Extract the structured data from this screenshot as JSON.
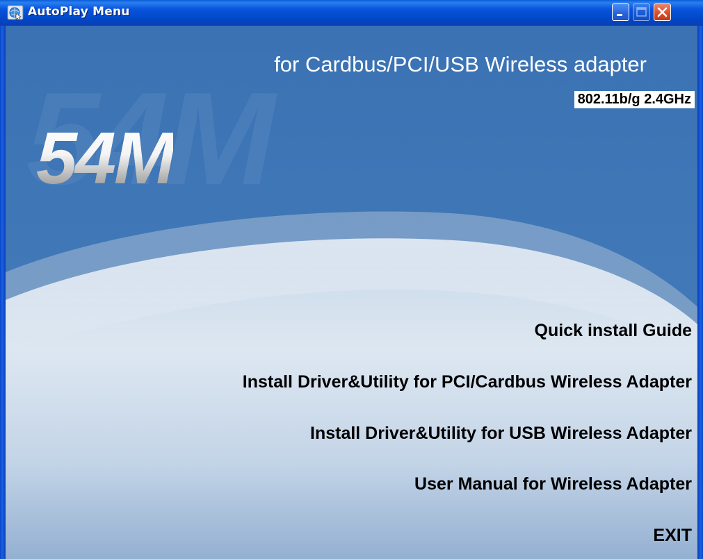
{
  "window": {
    "title": "AutoPlay Menu",
    "icon": "autoplay-globe-icon",
    "controls": [
      "minimize-icon",
      "maximize-icon",
      "close-icon"
    ]
  },
  "banner": {
    "subtitle": "for Cardbus/PCI/USB Wireless adapter",
    "spec": "802.11b/g  2.4GHz",
    "logo": "54M",
    "watermark": "54M"
  },
  "menu": {
    "quick_install": "Quick install Guide",
    "install_pci": "Install Driver&Utility for PCI/Cardbus Wireless Adapter",
    "install_usb": "Install Driver&Utility for USB Wireless Adapter",
    "user_manual": "User Manual for Wireless Adapter",
    "exit": "EXIT"
  },
  "colors": {
    "background": "#3f77b7",
    "titlebar": "#0855dd",
    "menu_text": "#000000",
    "header_text": "#ffffff"
  }
}
